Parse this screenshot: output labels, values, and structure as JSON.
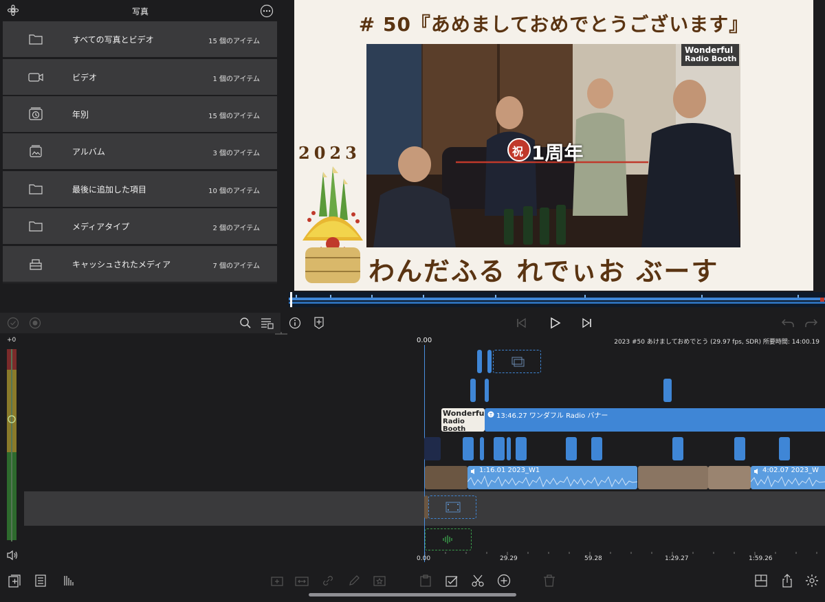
{
  "library": {
    "title": "写真",
    "items": [
      {
        "label": "すべての写真とビデオ",
        "count": "15 個のアイテム",
        "icon": "folder-icon"
      },
      {
        "label": "ビデオ",
        "count": "1 個のアイテム",
        "icon": "video-camera-icon"
      },
      {
        "label": "年別",
        "count": "15 個のアイテム",
        "icon": "calendar-clock-icon"
      },
      {
        "label": "アルバム",
        "count": "3 個のアイテム",
        "icon": "album-icon"
      },
      {
        "label": "最後に追加した項目",
        "count": "10 個のアイテム",
        "icon": "folder-icon"
      },
      {
        "label": "メディアタイプ",
        "count": "2 個のアイテム",
        "icon": "folder-icon"
      },
      {
        "label": "キャッシュされたメディア",
        "count": "7 個のアイテム",
        "icon": "cached-media-icon"
      }
    ]
  },
  "preview": {
    "title": "# 50『あめましておめでとうございます』",
    "year": "2023",
    "brand": "わんだふる れでぃお ぶーす",
    "overlay_logo_line1": "Wonderful",
    "overlay_logo_line2": "Radio Booth",
    "overlay_banner_mark": "祝",
    "overlay_banner_text": "1周年"
  },
  "timeline": {
    "playhead_time": "0.00",
    "project_info": "2023 #50 あけましておめでとう (29.97 fps, SDR) 所要時間: 14:00.19",
    "meter_level": "+0",
    "title_clip_label": "13:46.27  ワンダフル Radio バナー",
    "title_clip_logo1": "Wonderful",
    "title_clip_logo2": "Radio Booth",
    "main_clip1_label": "1:16.01  2023_W1",
    "main_clip2_label": "4:02.07  2023_W",
    "ruler_labels": [
      "0.00",
      "29.29",
      "59.28",
      "1:29.27",
      "1:59.26"
    ]
  },
  "colors": {
    "accent": "#3f86d6",
    "panel": "#3a3a3c",
    "background": "#1c1c1e",
    "brand_brown": "#5a3412"
  }
}
